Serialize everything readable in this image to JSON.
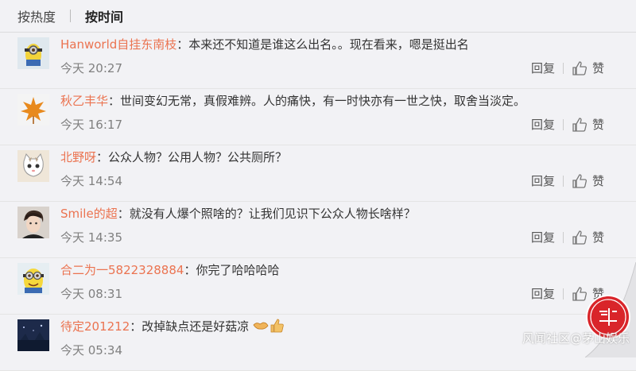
{
  "tabs": {
    "hot": "按热度",
    "time": "按时间"
  },
  "actions": {
    "reply": "回复",
    "like": "赞"
  },
  "comments": [
    {
      "user": "Hanworld自挂东南枝",
      "sep": "：",
      "text": "本来还不知道是谁这么出名。。现在看来，嗯是挺出名",
      "time": "今天 20:27",
      "avatar": "minion-avatar"
    },
    {
      "user": "秋乙丰华",
      "sep": "：",
      "text": "世间变幻无常，真假难辨。人的痛快，有一时快亦有一世之快，取舍当淡定。",
      "time": "今天 16:17",
      "avatar": "maple-leaf-avatar"
    },
    {
      "user": "北野呀",
      "sep": "：",
      "text": "公众人物？公用人物？公共厕所？",
      "time": "今天 14:54",
      "avatar": "cat-avatar"
    },
    {
      "user": "Smile的超",
      "sep": "：",
      "text": "就没有人爆个照啥的？让我们见识下公众人物长啥样？",
      "time": "今天 14:35",
      "avatar": "person-avatar"
    },
    {
      "user": "合二为一5822328884",
      "sep": "：",
      "text": "你完了哈哈哈哈",
      "time": "今天 08:31",
      "avatar": "minion-avatar"
    },
    {
      "user": "待定201212",
      "sep": "：",
      "text": "改掉缺点还是好菇凉",
      "time": "今天 05:34",
      "avatar": "night-scene-avatar"
    }
  ],
  "watermark": "风闻社区@茅山娱乐",
  "colors": {
    "username": "#eb7350",
    "text": "#333333",
    "meta": "#808080"
  }
}
